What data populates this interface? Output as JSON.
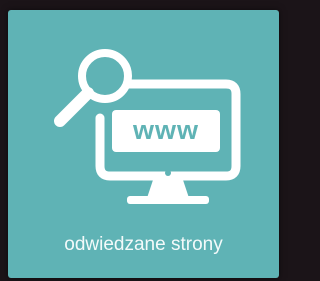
{
  "tile": {
    "label": "odwiedzane strony",
    "icon_text": "www",
    "icon": "monitor-magnifier-icon",
    "background_color": "#5fb3b5",
    "foreground_color": "#ffffff"
  }
}
